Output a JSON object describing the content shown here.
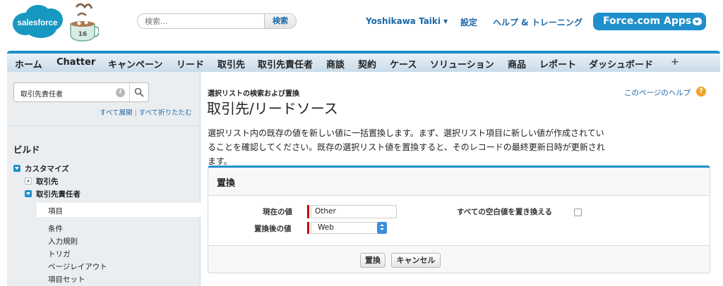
{
  "header": {
    "logo_text": "salesforce",
    "mascot_badge": "16",
    "search": {
      "placeholder": "検索...",
      "button_label": "検索"
    },
    "user_name": "Yoshikawa Taiki",
    "settings_link": "設定",
    "help_link": "ヘルプ & トレーニング",
    "apps_label": "Force.com Apps"
  },
  "colors": {
    "accent": "#1f8fcb",
    "link": "#1b68a8",
    "required": "#cc0000",
    "help": "#f0a328"
  },
  "tabs": [
    {
      "label": "ホーム"
    },
    {
      "label": "Chatter"
    },
    {
      "label": "キャンペーン"
    },
    {
      "label": "リード"
    },
    {
      "label": "取引先"
    },
    {
      "label": "取引先責任者"
    },
    {
      "label": "商談"
    },
    {
      "label": "契約"
    },
    {
      "label": "ケース"
    },
    {
      "label": "ソリューション"
    },
    {
      "label": "商品"
    },
    {
      "label": "レポート"
    },
    {
      "label": "ダッシュボード"
    },
    {
      "label": "+"
    }
  ],
  "sidebar": {
    "search_value": "取引先責任者",
    "expand_all": "すべて展開",
    "separator": "|",
    "collapse_all": "すべて折りたたむ",
    "heading": "ビルド",
    "tree": {
      "customize": "カスタマイズ",
      "accounts": "取引先",
      "contacts": "取引先責任者",
      "fields": "項目",
      "conditions": "条件",
      "validation_rules": "入力規則",
      "triggers": "トリガ",
      "page_layouts": "ページレイアウト",
      "field_sets": "項目セット"
    }
  },
  "main": {
    "breadcrumb": "選択リストの検索および置換",
    "title": "取引先/リードソース",
    "help_link": "このページのヘルプ",
    "description": "選択リスト内の既存の値を新しい値に一括置換します。まず、選択リスト項目に新しい値が作成されていることを確認してください。既存の選択リスト値を置換すると、そのレコードの最終更新日時が更新されます。",
    "panel": {
      "title": "置換",
      "current_value_label": "現在の値",
      "current_value": "Other",
      "new_value_label": "置換後の値",
      "new_value": "Web",
      "replace_blank_label": "すべての空白値を置き換える",
      "replace_button": "置換",
      "cancel_button": "キャンセル"
    }
  }
}
